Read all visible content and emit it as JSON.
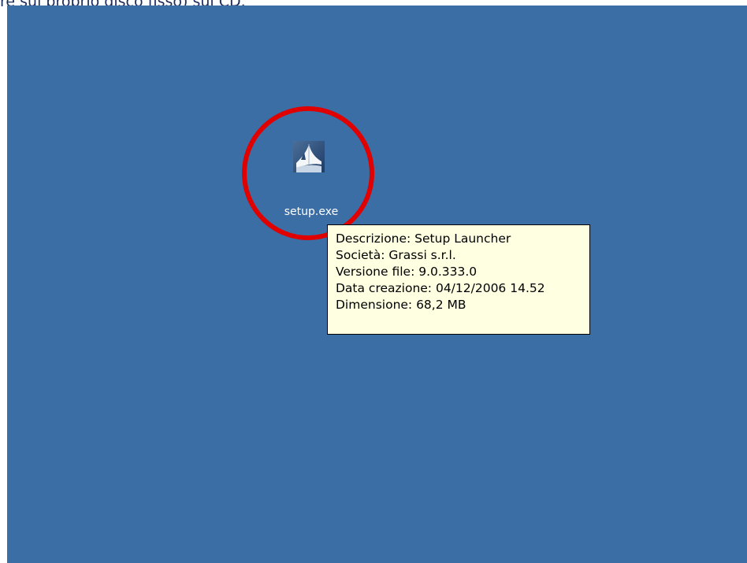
{
  "caption": "re sul proprio disco fisso) sul CD.",
  "colors": {
    "desktop_background": "#3a6ea5",
    "highlight_circle": "#e00000",
    "tooltip_background": "#ffffe1"
  },
  "desktop": {
    "icon": {
      "label": "setup.exe",
      "icon_name": "setup-launcher-icon"
    },
    "tooltip": {
      "lines": [
        "Descrizione: Setup Launcher",
        "Società: Grassi s.r.l.",
        "Versione file: 9.0.333.0",
        "Data creazione: 04/12/2006 14.52",
        "Dimensione: 68,2 MB"
      ]
    }
  }
}
